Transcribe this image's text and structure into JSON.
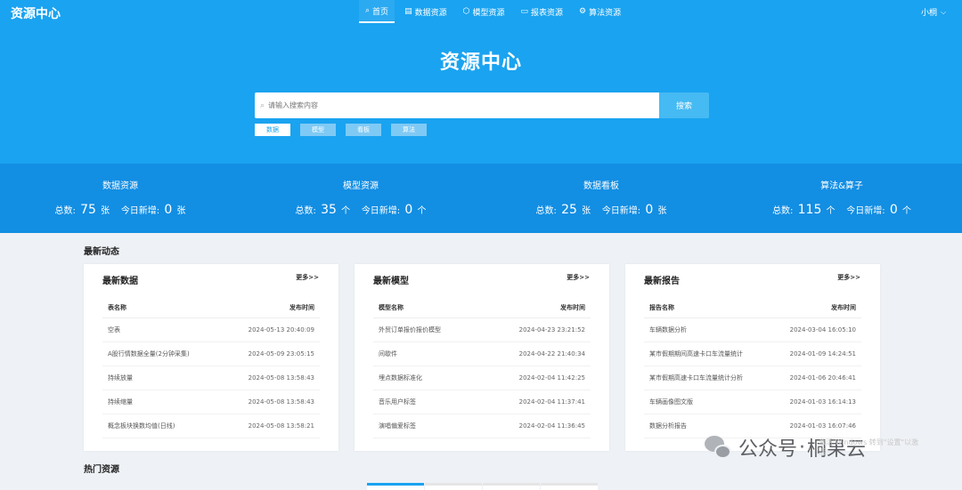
{
  "header": {
    "logo": "资源中心",
    "nav": [
      {
        "icon": "⌕",
        "label": "首页"
      },
      {
        "icon": "▤",
        "label": "数据资源"
      },
      {
        "icon": "⬡",
        "label": "模型资源"
      },
      {
        "icon": "▭",
        "label": "报表资源"
      },
      {
        "icon": "⚙",
        "label": "算法资源"
      }
    ],
    "user": "小桐",
    "user_chevron": "⌵"
  },
  "hero": {
    "title": "资源中心",
    "search_placeholder": "请输入搜索内容",
    "search_button": "搜索",
    "filters": [
      "数据",
      "模型",
      "看板",
      "算法"
    ]
  },
  "stats": [
    {
      "label": "数据资源",
      "total_label": "总数:",
      "total": "75",
      "total_unit": "张",
      "new_label": "今日新增:",
      "new": "0",
      "new_unit": "张"
    },
    {
      "label": "模型资源",
      "total_label": "总数:",
      "total": "35",
      "total_unit": "个",
      "new_label": "今日新增:",
      "new": "0",
      "new_unit": "个"
    },
    {
      "label": "数据看板",
      "total_label": "总数:",
      "total": "25",
      "total_unit": "张",
      "new_label": "今日新增:",
      "new": "0",
      "new_unit": "张"
    },
    {
      "label": "算法&算子",
      "total_label": "总数:",
      "total": "115",
      "total_unit": "个",
      "new_label": "今日新增:",
      "new": "0",
      "new_unit": "个"
    }
  ],
  "latest": {
    "section_title": "最新动态",
    "cards": [
      {
        "title": "最新数据",
        "more": "更多>>",
        "col_name": "表名称",
        "col_time": "发布时间",
        "rows": [
          {
            "name": "空表",
            "time": "2024-05-13 20:40:09"
          },
          {
            "name": "A股行情数据全量(2分钟采集)",
            "time": "2024-05-09 23:05:15"
          },
          {
            "name": "持续放量",
            "time": "2024-05-08 13:58:43"
          },
          {
            "name": "持续缩量",
            "time": "2024-05-08 13:58:43"
          },
          {
            "name": "概念板块换数均值(日线)",
            "time": "2024-05-08 13:58:21"
          }
        ]
      },
      {
        "title": "最新模型",
        "more": "更多>>",
        "col_name": "模型名称",
        "col_time": "发布时间",
        "rows": [
          {
            "name": "外贸订单报价报价模型",
            "time": "2024-04-23 23:21:52"
          },
          {
            "name": "间歇件",
            "time": "2024-04-22 21:40:34"
          },
          {
            "name": "埋点数据标准化",
            "time": "2024-02-04 11:42:25"
          },
          {
            "name": "音乐用户标签",
            "time": "2024-02-04 11:37:41"
          },
          {
            "name": "演唱偏爱标签",
            "time": "2024-02-04 11:36:45"
          }
        ]
      },
      {
        "title": "最新报告",
        "more": "更多>>",
        "col_name": "报告名称",
        "col_time": "发布时间",
        "rows": [
          {
            "name": "车辆数据分析",
            "time": "2024-03-04 16:05:10"
          },
          {
            "name": "某市假期期间高速卡口车流量统计",
            "time": "2024-01-09 14:24:51"
          },
          {
            "name": "某市假期高速卡口车流量统计分析",
            "time": "2024-01-06 20:46:41"
          },
          {
            "name": "车辆画像图文版",
            "time": "2024-01-03 16:14:13"
          },
          {
            "name": "数据分析报告",
            "time": "2024-01-03 16:07:46"
          }
        ]
      }
    ]
  },
  "hot": {
    "section_title": "热门资源"
  },
  "watermark": {
    "gzh": "公众号",
    "dot": "·",
    "brand": "桐果云",
    "faint": "激活 Windows 转到\"设置\"以激活"
  }
}
